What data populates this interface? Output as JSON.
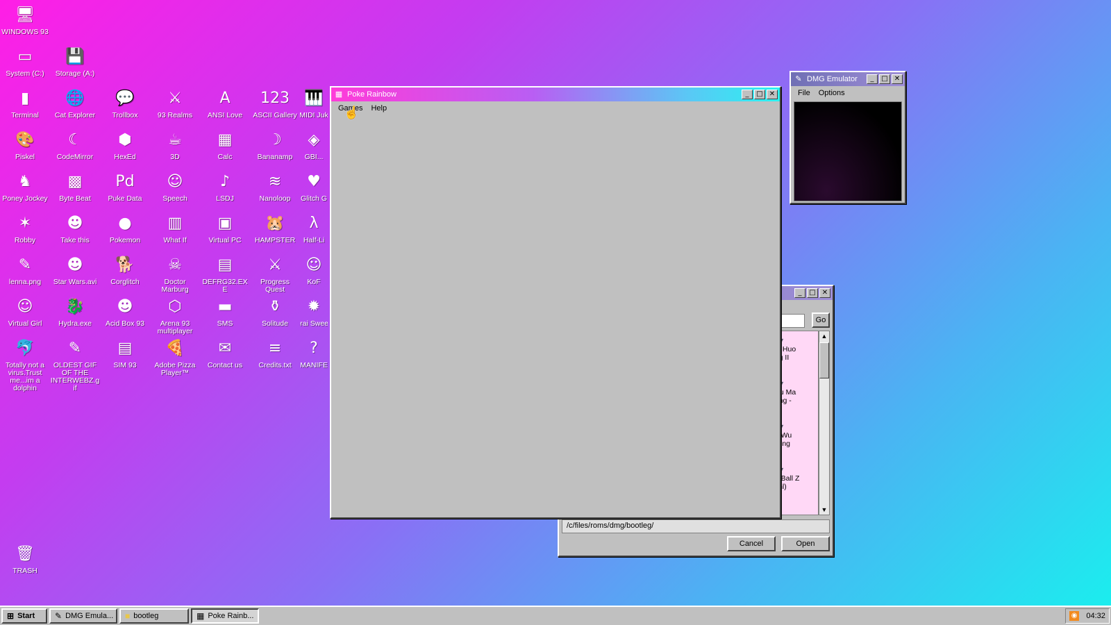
{
  "desktop": {
    "icons": [
      {
        "label": "WINDOWS 93",
        "glyph": "🖥",
        "icon": "computer-icon"
      },
      {
        "label": "System (C:)",
        "glyph": "▭",
        "icon": "drive-icon"
      },
      {
        "label": "Storage (A:)",
        "glyph": "💾",
        "icon": "floppy-drive-icon"
      },
      {
        "label": "Terminal",
        "glyph": "▮",
        "icon": "terminal-icon"
      },
      {
        "label": "Cat Explorer",
        "glyph": "🌐",
        "icon": "globe-icon"
      },
      {
        "label": "Trollbox",
        "glyph": "💬",
        "icon": "chat-icon"
      },
      {
        "label": "93 Realms",
        "glyph": "⚔",
        "icon": "realms-icon"
      },
      {
        "label": "ANSI Love",
        "glyph": "A",
        "icon": "ansi-icon"
      },
      {
        "label": "ASCII Gallery",
        "glyph": "123",
        "icon": "ascii-icon"
      },
      {
        "label": "MIDI Juk",
        "glyph": "🎹",
        "icon": "piano-icon"
      },
      {
        "label": "Piskel",
        "glyph": "🎨",
        "icon": "palette-icon"
      },
      {
        "label": "CodeMirror",
        "glyph": "☾",
        "icon": "codemirror-icon"
      },
      {
        "label": "HexEd",
        "glyph": "⬢",
        "icon": "hexagon-icon"
      },
      {
        "label": "3D",
        "glyph": "☕",
        "icon": "teapot-icon"
      },
      {
        "label": "Calc",
        "glyph": "▦",
        "icon": "calculator-icon"
      },
      {
        "label": "Bananamp",
        "glyph": "☽",
        "icon": "banana-icon"
      },
      {
        "label": "GBI...",
        "glyph": "◈",
        "icon": "gb-icon"
      },
      {
        "label": "Poney Jockey",
        "glyph": "♞",
        "icon": "pony-icon"
      },
      {
        "label": "Byte Beat",
        "glyph": "▩",
        "icon": "bytebeat-icon"
      },
      {
        "label": "Puke Data",
        "glyph": "Pd",
        "icon": "pd-icon"
      },
      {
        "label": "Speech",
        "glyph": "☺",
        "icon": "face-icon"
      },
      {
        "label": "LSDJ",
        "glyph": "♪",
        "icon": "lsdj-icon"
      },
      {
        "label": "Nanoloop",
        "glyph": "≋",
        "icon": "wave-icon"
      },
      {
        "label": "Glitch G",
        "glyph": "♥",
        "icon": "lips-icon"
      },
      {
        "label": "Robby",
        "glyph": "✶",
        "icon": "stickman-icon"
      },
      {
        "label": "Take this",
        "glyph": "☻",
        "icon": "character-icon"
      },
      {
        "label": "Pokemon",
        "glyph": "●",
        "icon": "pokeball-icon"
      },
      {
        "label": "What If",
        "glyph": "▥",
        "icon": "whatif-icon"
      },
      {
        "label": "Virtual PC",
        "glyph": "▣",
        "icon": "virtual-pc-icon"
      },
      {
        "label": "HAMPSTER",
        "glyph": "🐹",
        "icon": "hamster-icon"
      },
      {
        "label": "Half-Li",
        "glyph": "λ",
        "icon": "lambda-icon"
      },
      {
        "label": "lenna.png",
        "glyph": "✎",
        "icon": "image-file-icon"
      },
      {
        "label": "Star Wars.avi",
        "glyph": "☻",
        "icon": "yoda-icon"
      },
      {
        "label": "Corglitch",
        "glyph": "🐕",
        "icon": "corgi-icon"
      },
      {
        "label": "Doctor Marburg",
        "glyph": "☠",
        "icon": "doctor-icon"
      },
      {
        "label": "DEFRG32.EXE",
        "glyph": "▤",
        "icon": "defrag-icon"
      },
      {
        "label": "Progress Quest",
        "glyph": "⚔",
        "icon": "swords-icon"
      },
      {
        "label": "KoF",
        "glyph": "☺",
        "icon": "fighter-icon"
      },
      {
        "label": "Virtual Girl",
        "glyph": "☺",
        "icon": "girl-icon"
      },
      {
        "label": "Hydra.exe",
        "glyph": "🐉",
        "icon": "hydra-icon"
      },
      {
        "label": "Acid Box 93",
        "glyph": "☻",
        "icon": "smiley-icon"
      },
      {
        "label": "Arena 93 multiplayer",
        "glyph": "⬡",
        "icon": "cube-icon"
      },
      {
        "label": "SMS",
        "glyph": "▬",
        "icon": "console-icon"
      },
      {
        "label": "Solitude",
        "glyph": "⚱",
        "icon": "bottle-icon"
      },
      {
        "label": "Brai Sweep",
        "glyph": "✹",
        "icon": "brain-icon"
      },
      {
        "label": "Totally not a virus.Trust me...im a dolphin",
        "glyph": "🐬",
        "icon": "dolphin-icon"
      },
      {
        "label": "OLDEST GIF OF THE INTERWEBZ.gif",
        "glyph": "✎",
        "icon": "gif-file-icon"
      },
      {
        "label": "SIM 93",
        "glyph": "▤",
        "icon": "sim-icon"
      },
      {
        "label": "Adobe Pizza Player™",
        "glyph": "🍕",
        "icon": "pizza-icon"
      },
      {
        "label": "Contact us",
        "glyph": "✉",
        "icon": "contact-icon"
      },
      {
        "label": "Credits.txt",
        "glyph": "≡",
        "icon": "text-file-icon"
      },
      {
        "label": "MANIFE",
        "glyph": "?",
        "icon": "question-icon"
      },
      {
        "label": "TRASH",
        "glyph": "🗑",
        "icon": "trash-icon"
      }
    ]
  },
  "poke_window": {
    "title": "Poke Rainbow",
    "menu": [
      "Games",
      "Help"
    ]
  },
  "dmg_window": {
    "title": "DMG Emulator",
    "menu": [
      "File",
      "Options"
    ]
  },
  "file_dialog": {
    "go_label": "Go",
    "items": [
      "Gu Huo\nang II",
      "Shu Ma\nLong -",
      "ng Wu\no Jing",
      "on Ball Z\n(Unl)"
    ],
    "path": "/c/files/roms/dmg/bootleg/",
    "cancel_label": "Cancel",
    "open_label": "Open"
  },
  "taskbar": {
    "start_label": "Start",
    "tasks": [
      {
        "label": "DMG Emula...",
        "icon": "gamepad-icon"
      },
      {
        "label": "bootleg",
        "icon": "folder-icon"
      },
      {
        "label": "Poke Rainb...",
        "icon": "poke-icon"
      }
    ],
    "clock": "04:32"
  },
  "colors": {
    "desktop_top": "#ff1ee6",
    "desktop_bottom": "#19f0ee",
    "window_face": "#c0c0c0"
  }
}
